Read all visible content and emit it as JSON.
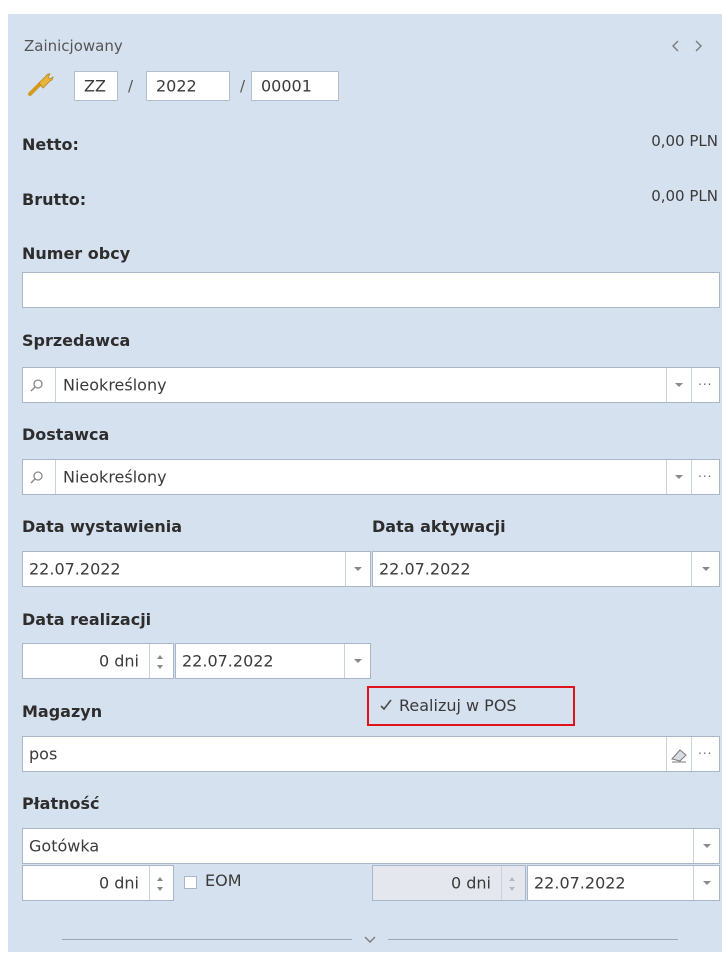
{
  "header": {
    "status": "Zainicjowany",
    "number_segments": [
      "ZZ",
      "2022",
      "00001"
    ],
    "separator": "/"
  },
  "totals": {
    "netto_label": "Netto:",
    "netto_value": "0,00 PLN",
    "brutto_label": "Brutto:",
    "brutto_value": "0,00 PLN"
  },
  "numer_obcy": {
    "label": "Numer obcy",
    "value": ""
  },
  "sprzedawca": {
    "label": "Sprzedawca",
    "value": "Nieokreślony"
  },
  "dostawca": {
    "label": "Dostawca",
    "value": "Nieokreślony"
  },
  "data_wystawienia": {
    "label": "Data wystawienia",
    "value": "22.07.2022"
  },
  "data_aktywacji": {
    "label": "Data aktywacji",
    "value": "22.07.2022"
  },
  "data_realizacji": {
    "label": "Data realizacji",
    "days": "0 dni",
    "date": "22.07.2022"
  },
  "realizuj_pos": {
    "label": "Realizuj w POS",
    "checked": true,
    "highlight_color": "#e0131a"
  },
  "magazyn": {
    "label": "Magazyn",
    "value": "pos"
  },
  "platnosc": {
    "label": "Płatność",
    "method": "Gotówka",
    "days": "0 dni",
    "eom_label": "EOM",
    "eom_checked": false,
    "due_days": "0 dni",
    "due_date": "22.07.2022"
  },
  "colors": {
    "panel_bg": "#d6e1f0",
    "field_border": "#a9b6c8",
    "accent_icon": "#e0a92a"
  },
  "icons": {
    "prev": "chevron-left-icon",
    "next": "chevron-right-icon",
    "wrench": "wrench-icon",
    "search": "search-icon",
    "dropdown": "chevron-down-icon",
    "more": "ellipsis-icon",
    "eraser": "eraser-icon",
    "expand": "expand-chevron-icon"
  }
}
